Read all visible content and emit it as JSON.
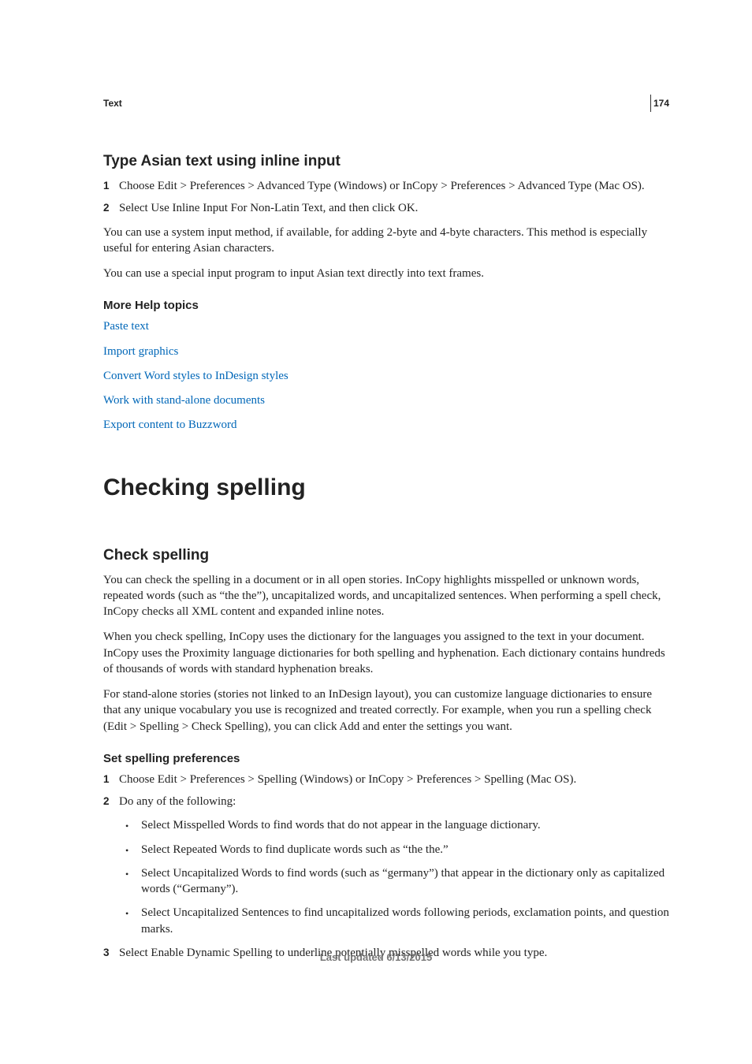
{
  "page_number": "174",
  "section_label": "Text",
  "footer": "Last updated 6/13/2015",
  "type_asian": {
    "heading": "Type Asian text using inline input",
    "steps": [
      "Choose Edit > Preferences > Advanced Type (Windows) or InCopy > Preferences > Advanced Type (Mac OS).",
      "Select Use Inline Input For Non-Latin Text, and then click OK."
    ],
    "para1": "You can use a system input method, if available, for adding 2-byte and 4-byte characters. This method is especially useful for entering Asian characters.",
    "para2": "You can use a special input program to input Asian text directly into text frames."
  },
  "more_help": {
    "heading": "More Help topics",
    "links": [
      "Paste text",
      "Import graphics",
      "Convert Word styles to InDesign styles",
      "Work with stand-alone documents",
      "Export content to Buzzword"
    ]
  },
  "checking_spelling_title": "Checking spelling",
  "check_spelling": {
    "heading": "Check spelling",
    "para1": "You can check the spelling in a document or in all open stories. InCopy highlights misspelled or unknown words, repeated words (such as “the the”), uncapitalized words, and uncapitalized sentences. When performing a spell check, InCopy checks all XML content and expanded inline notes.",
    "para2": "When you check spelling, InCopy uses the dictionary for the languages you assigned to the text in your document. InCopy uses the Proximity language dictionaries for both spelling and hyphenation. Each dictionary contains hundreds of thousands of words with standard hyphenation breaks.",
    "para3": "For stand-alone stories (stories not linked to an InDesign layout), you can customize language dictionaries to ensure that any unique vocabulary you use is recognized and treated correctly. For example, when you run a spelling check (Edit > Spelling > Check Spelling), you can click Add and enter the settings you want."
  },
  "set_prefs": {
    "heading": "Set spelling preferences",
    "steps": {
      "s1": "Choose Edit > Preferences > Spelling (Windows) or InCopy > Preferences > Spelling (Mac OS).",
      "s2": "Do any of the following:",
      "bullets": [
        "Select Misspelled Words to find words that do not appear in the language dictionary.",
        "Select Repeated Words to find duplicate words such as “the the.”",
        "Select Uncapitalized Words to find words (such as “germany”) that appear in the dictionary only as capitalized words (“Germany”).",
        "Select Uncapitalized Sentences to find uncapitalized words following periods, exclamation points, and question marks."
      ],
      "s3": "Select Enable Dynamic Spelling to underline potentially misspelled words while you type."
    }
  }
}
